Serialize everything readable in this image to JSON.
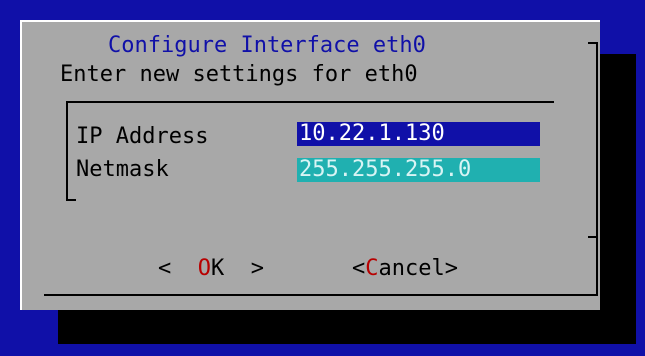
{
  "dialog": {
    "title": "Configure Interface eth0",
    "prompt": "Enter new settings for eth0"
  },
  "form": {
    "fields": [
      {
        "label": "IP Address",
        "value": "10.22.1.130"
      },
      {
        "label": "Netmask",
        "value": "255.255.255.0"
      }
    ]
  },
  "buttons": {
    "ok": {
      "left": "<",
      "hotkey": "O",
      "rest": "K",
      "right": ">"
    },
    "cancel": {
      "left": "<",
      "hotkey": "C",
      "rest": "ancel",
      "right": ">"
    }
  },
  "colors": {
    "screen_bg": "#1010a8",
    "dialog_bg": "#a8a8a8",
    "title": "#1010a8",
    "focused_field_bg": "#1010a8",
    "inactive_field_bg": "#20b0b0",
    "hotkey": "#b80000"
  }
}
